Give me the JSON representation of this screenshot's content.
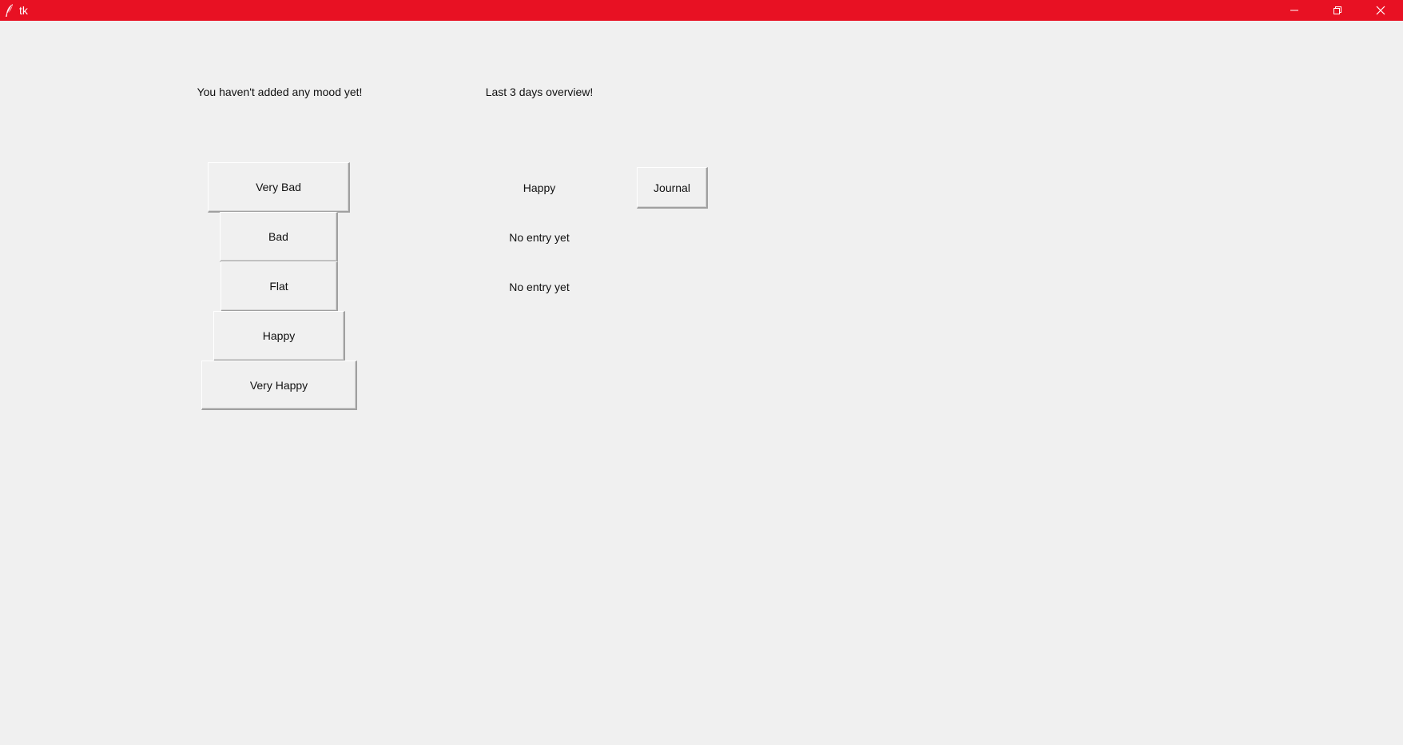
{
  "window": {
    "title": "tk",
    "titlebar_color": "#e81123",
    "controls": [
      "minimize-icon",
      "maximize-icon",
      "close-icon"
    ]
  },
  "status": {
    "mood_message": "You haven't added any mood yet!",
    "overview_title": "Last 3 days overview!"
  },
  "mood_buttons": [
    {
      "label": "Very Bad"
    },
    {
      "label": "Bad"
    },
    {
      "label": "Flat"
    },
    {
      "label": "Happy"
    },
    {
      "label": "Very Happy"
    }
  ],
  "overview": [
    {
      "text": "Happy"
    },
    {
      "text": "No entry yet"
    },
    {
      "text": "No entry yet"
    }
  ],
  "journal_button": {
    "label": "Journal"
  }
}
